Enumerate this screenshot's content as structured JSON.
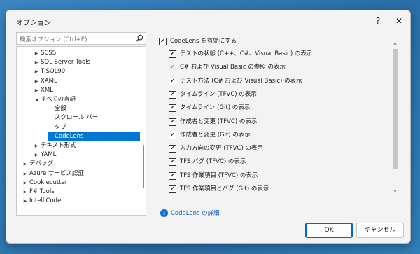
{
  "dialog": {
    "title": "オプション",
    "help": "?",
    "close": "✕"
  },
  "search": {
    "placeholder": "検索オプション (Ctrl+E)"
  },
  "tree": [
    {
      "label": "SCSS",
      "arrow": "▶"
    },
    {
      "label": "SQL Server Tools",
      "arrow": "▶"
    },
    {
      "label": "T-SQL90",
      "arrow": "▶"
    },
    {
      "label": "XAML",
      "arrow": "▶"
    },
    {
      "label": "XML",
      "arrow": "▶"
    },
    {
      "label": "すべての言語",
      "arrow": "◢"
    },
    {
      "label": "全般",
      "arrow": ""
    },
    {
      "label": "スクロール バー",
      "arrow": ""
    },
    {
      "label": "タブ",
      "arrow": ""
    },
    {
      "label": "CodeLens",
      "arrow": "",
      "selected": true
    },
    {
      "label": "テキスト形式",
      "arrow": "▶"
    },
    {
      "label": "YAML",
      "arrow": "▶"
    },
    {
      "label": "デバッグ",
      "arrow": "▶"
    },
    {
      "label": "Azure サービス認証",
      "arrow": "▶"
    },
    {
      "label": "Cookiecutter",
      "arrow": "▶"
    },
    {
      "label": "F# Tools",
      "arrow": "▶"
    },
    {
      "label": "IntelliCode",
      "arrow": "▶"
    }
  ],
  "options": {
    "enable_codelens": "CodeLens を有効にする",
    "items": [
      {
        "label": "テストの状態 (C++、C#、Visual Basic) の表示",
        "checked": true
      },
      {
        "label": "C# および Visual Basic の参照 の表示",
        "checked": true,
        "disabled": true
      },
      {
        "label": "テスト方法 (C# および Visual Basic) の表示",
        "checked": true
      },
      {
        "label": "タイムライン (TFVC) の表示",
        "checked": true
      },
      {
        "label": "タイムライン (Git) の表示",
        "checked": true
      },
      {
        "label": "作成者と変更 (TFVC) の表示",
        "checked": true
      },
      {
        "label": "作成者と変更 (Git) の表示",
        "checked": true
      },
      {
        "label": "入力方向の変更 (TFVC) の表示",
        "checked": true
      },
      {
        "label": "TFS バグ (TFVC) の表示",
        "checked": true
      },
      {
        "label": "TFS 作業項目 (TFVC) の表示",
        "checked": true
      },
      {
        "label": "TFS 作業項目とバグ (Git) の表示",
        "checked": true
      }
    ]
  },
  "info_link": "CodeLens の詳細",
  "buttons": {
    "ok": "OK",
    "cancel": "キャンセル"
  },
  "check_glyph": "✔",
  "colors": {
    "selection": "#0078d4",
    "link": "#0b62c4",
    "desktop": "#2f7fb8"
  }
}
